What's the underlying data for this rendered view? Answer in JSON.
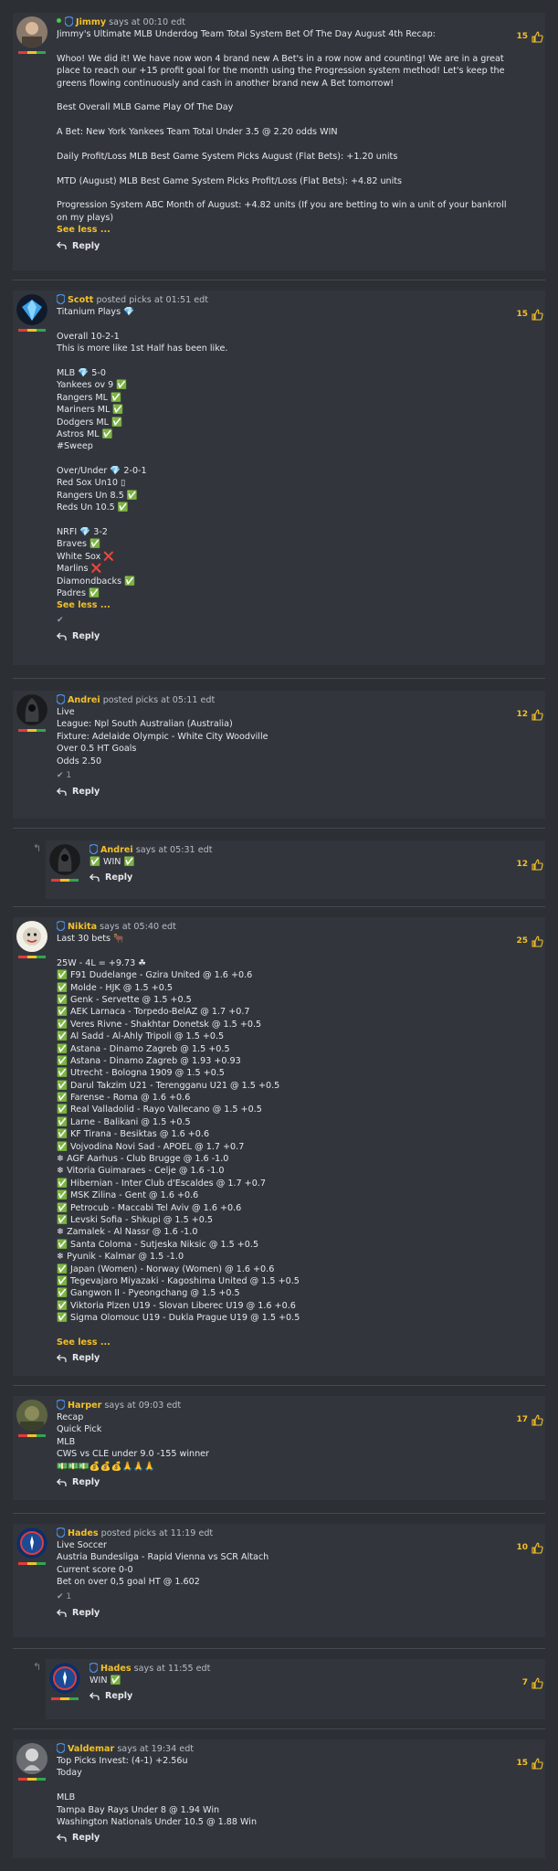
{
  "colors": {
    "accent": "#f4c028",
    "background": "#2c2f34",
    "card": "#32363c",
    "win": "#2fa84f",
    "loss": "#e2443b"
  },
  "posts": [
    {
      "user": "Jimmy",
      "action": "says at 00:10 edt",
      "online": true,
      "likes": "15",
      "lines": [
        "Jimmy's Ultimate MLB Underdog Team Total System Bet Of The Day August 4th Recap:",
        "",
        "Whoo! We did it! We have now won 4 brand new A Bet's in a row now and counting! We are in a great",
        "place to reach our +15 profit goal for the month using the Progression system method! Let's keep the",
        "greens flowing continuously and cash in another brand new A Bet tomorrow!",
        "",
        "Best Overall MLB Game Play Of The Day",
        "",
        "A Bet: New York Yankees Team Total Under 3.5 @ 2.20 odds WIN",
        "",
        "Daily Profit/Loss MLB Best Game System Picks August (Flat Bets): +1.20 units",
        "",
        "MTD (August) MLB Best Game System Picks Profit/Loss (Flat Bets): +4.82 units",
        "",
        "Progression System ABC Month of August: +4.82 units (If you are betting to win a unit of your bankroll",
        "on my plays)"
      ],
      "see_label": "See less ...",
      "reply_label": "Reply"
    },
    {
      "user": "Scott",
      "action": "posted picks at 01:51 edt",
      "likes": "15",
      "lines": [
        "Titanium Plays 💎",
        "",
        "Overall 10-2-1",
        "This is more like 1st Half has been like.",
        "",
        "MLB 💎 5-0",
        "Yankees ov 9 ✅",
        "Rangers ML ✅",
        "Mariners ML ✅",
        "Dodgers ML ✅",
        "Astros ML ✅",
        "#Sweep",
        "",
        "Over/Under 💎 2-0-1",
        "Red Sox Un10 ▯",
        "Rangers Un 8.5 ✅",
        "Reds Un 10.5 ✅",
        "",
        "NRFI 💎 3-2",
        "Braves ✅",
        "White Sox ❌",
        "Marlins ❌",
        "Diamondbacks ✅",
        "Padres ✅"
      ],
      "see_label": "See less ...",
      "ticks": "✔",
      "reply_label": "Reply"
    },
    {
      "user": "Andrei",
      "action": "posted picks at 05:11 edt",
      "likes": "12",
      "lines": [
        "Live",
        "League: Npl South Australian (Australia)",
        "Fixture: Adelaide Olympic - White City Woodville",
        "Over 0.5 HT Goals",
        "Odds 2.50"
      ],
      "ticks": "✔ 1",
      "reply_label": "Reply"
    },
    {
      "user": "Andrei",
      "action": "says at 05:31 edt",
      "likes": "12",
      "lines": [
        "✅ WIN ✅"
      ],
      "reply_label": "Reply"
    },
    {
      "user": "Nikita",
      "action": "says at 05:40 edt",
      "likes": "25",
      "lines": [
        "Last 30 bets 🐂",
        "",
        "25W - 4L = +9.73 ☘",
        "✅ F91 Dudelange - Gzira United @ 1.6 +0.6",
        "✅ Molde - HJK @ 1.5 +0.5",
        "✅ Genk - Servette @ 1.5 +0.5",
        "✅ AEK Larnaca - Torpedo-BelAZ @ 1.7 +0.7",
        "✅ Veres Rivne - Shakhtar Donetsk @ 1.5 +0.5",
        "✅ Al Sadd - Al-Ahly Tripoli @ 1.5 +0.5",
        "✅ Astana - Dinamo Zagreb @ 1.5 +0.5",
        "✅ Astana - Dinamo Zagreb @ 1.93 +0.93",
        "✅ Utrecht - Bologna 1909 @ 1.5 +0.5",
        "✅ Darul Takzim U21 - Terengganu U21 @ 1.5 +0.5",
        "✅ Farense - Roma @ 1.6 +0.6",
        "✅ Real Valladolid - Rayo Vallecano @ 1.5 +0.5",
        "✅ Larne - Balikani @ 1.5 +0.5",
        "✅ KF Tirana - Besiktas @ 1.6 +0.6",
        "✅ Vojvodina Novi Sad - APOEL @ 1.7 +0.7",
        "❄ AGF Aarhus - Club Brugge @ 1.6 -1.0",
        "❄ Vitoria Guimaraes - Celje @ 1.6 -1.0",
        "✅ Hibernian - Inter Club d'Escaldes @ 1.7 +0.7",
        "✅ MSK Zilina - Gent @ 1.6 +0.6",
        "✅ Petrocub - Maccabi Tel Aviv @ 1.6 +0.6",
        "✅ Levski Sofia - Shkupi @ 1.5 +0.5",
        "❄ Zamalek - Al Nassr @ 1.6 -1.0",
        "✅ Santa Coloma - Sutjeska Niksic @ 1.5 +0.5",
        "❄ Pyunik - Kalmar @ 1.5 -1.0",
        "✅ Japan (Women) - Norway (Women) @ 1.6 +0.6",
        "✅ Tegevajaro Miyazaki - Kagoshima United @ 1.5 +0.5",
        "✅ Gangwon II - Pyeongchang @ 1.5 +0.5",
        "✅ Viktoria Plzen U19 - Slovan Liberec U19 @ 1.6 +0.6",
        "✅ Sigma Olomouc U19 - Dukla Prague U19 @ 1.5 +0.5"
      ],
      "see_label": "See less ...",
      "reply_label": "Reply"
    },
    {
      "user": "Harper",
      "action": "says at 09:03 edt",
      "likes": "17",
      "lines": [
        "Recap",
        "Quick Pick",
        "MLB",
        "CWS vs CLE under 9.0 -155 winner",
        "💵💵💵💰💰💰🙏🙏🙏"
      ],
      "reply_label": "Reply"
    },
    {
      "user": "Hades",
      "action": "posted picks at 11:19 edt",
      "likes": "10",
      "lines": [
        "Live Soccer",
        "Austria Bundesliga - Rapid Vienna vs SCR Altach",
        "Current score 0-0",
        "Bet on over 0,5 goal HT @ 1.602"
      ],
      "ticks": "✔ 1",
      "reply_label": "Reply"
    },
    {
      "user": "Hades",
      "action": "says at 11:55 edt",
      "likes": "7",
      "lines": [
        "WIN ✅"
      ],
      "reply_label": "Reply"
    },
    {
      "user": "Valdemar",
      "action": "says at 19:34 edt",
      "likes": "15",
      "lines": [
        "Top Picks Invest: (4-1) +2.56u",
        "Today",
        "",
        "MLB",
        "Tampa Bay Rays Under 8 @ 1.94 Win",
        "Washington Nationals Under 10.5 @ 1.88 Win"
      ],
      "reply_label": "Reply"
    }
  ]
}
